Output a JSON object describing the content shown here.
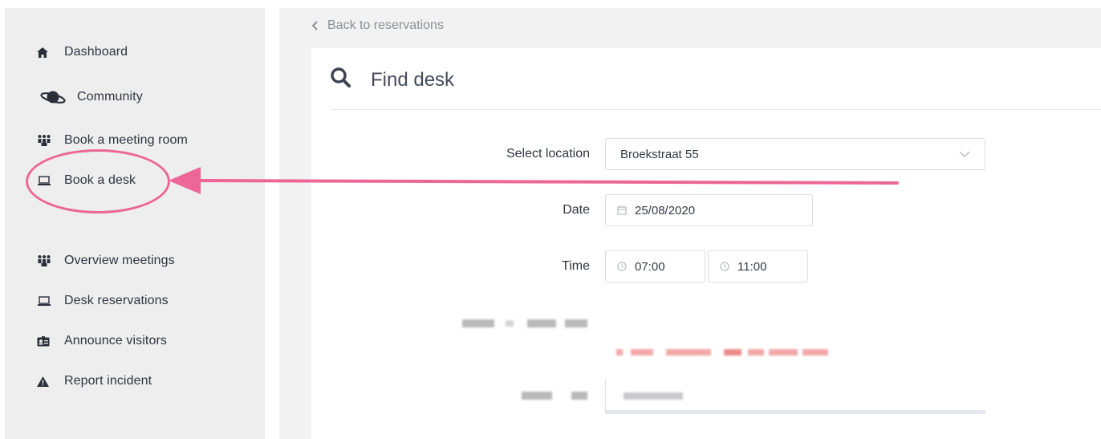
{
  "sidebar": {
    "items": [
      {
        "label": "Dashboard",
        "icon": "home-icon"
      },
      {
        "label": "Community",
        "icon": "planet-icon"
      },
      {
        "label": "Book a meeting room",
        "icon": "people-icon"
      },
      {
        "label": "Book a desk",
        "icon": "laptop-icon"
      },
      {
        "label": "Overview meetings",
        "icon": "people-icon"
      },
      {
        "label": "Desk reservations",
        "icon": "laptop-icon"
      },
      {
        "label": "Announce visitors",
        "icon": "id-card-icon"
      },
      {
        "label": "Report incident",
        "icon": "warning-icon"
      }
    ]
  },
  "header": {
    "back_label": "Back to reservations",
    "title": "Find desk"
  },
  "form": {
    "location_label": "Select location",
    "location_value": "Broekstraat 55",
    "date_label": "Date",
    "date_value": "25/08/2020",
    "time_label": "Time",
    "time_start": "07:00",
    "time_end": "11:00"
  },
  "annotation": {
    "highlight_color": "#ec6795",
    "highlighted_item": "Book a desk"
  }
}
